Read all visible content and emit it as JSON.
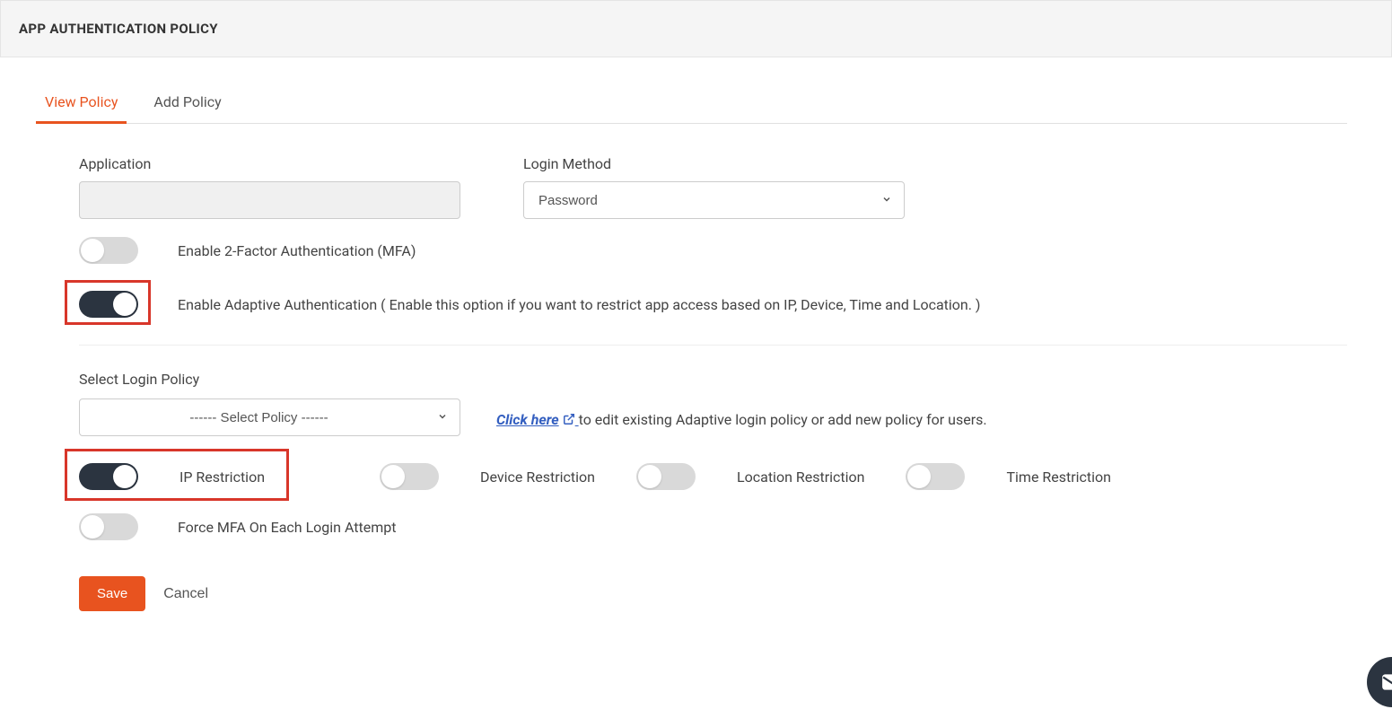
{
  "header": {
    "title": "APP AUTHENTICATION POLICY"
  },
  "tabs": {
    "view": "View Policy",
    "add": "Add Policy"
  },
  "fields": {
    "application_label": "Application",
    "application_value": "",
    "login_method_label": "Login Method",
    "login_method_value": "Password"
  },
  "toggles": {
    "mfa": "Enable 2-Factor Authentication (MFA)",
    "adaptive": "Enable Adaptive Authentication ( Enable this option if you want to restrict app access based on IP, Device, Time and Location. )",
    "ip": "IP Restriction",
    "device": "Device Restriction",
    "location": "Location Restriction",
    "time": "Time Restriction",
    "force_mfa": "Force MFA On Each Login Attempt"
  },
  "login_policy": {
    "label": "Select Login Policy",
    "placeholder": "------ Select Policy ------",
    "link_text": "Click here",
    "help_suffix": " to edit existing Adaptive login policy or add new policy for users."
  },
  "actions": {
    "save": "Save",
    "cancel": "Cancel"
  }
}
